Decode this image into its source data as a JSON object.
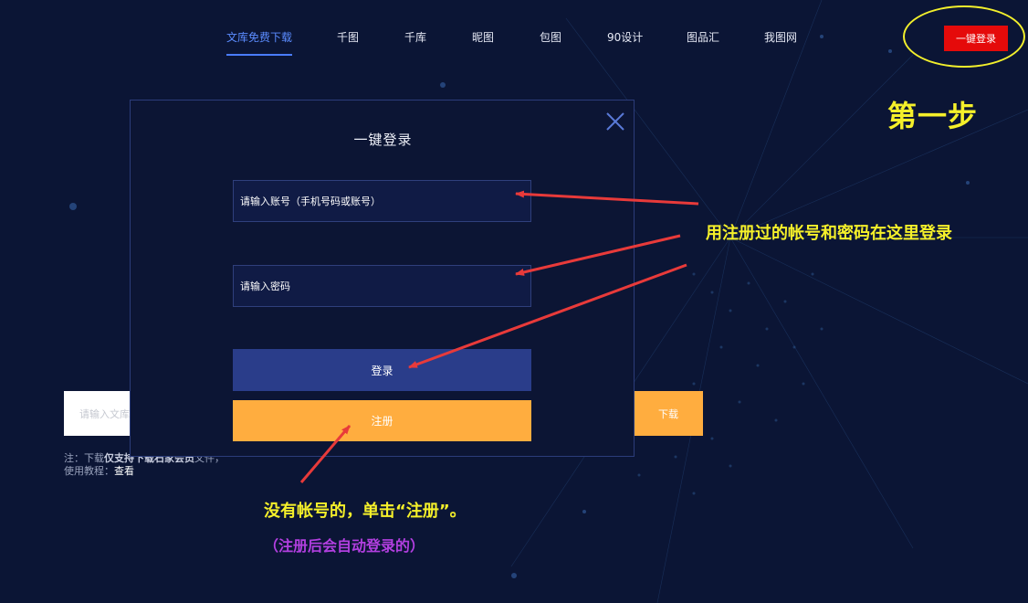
{
  "nav": {
    "items": [
      {
        "label": "文库免费下载",
        "active": true
      },
      {
        "label": "千图",
        "active": false
      },
      {
        "label": "千库",
        "active": false
      },
      {
        "label": "昵图",
        "active": false
      },
      {
        "label": "包图",
        "active": false
      },
      {
        "label": "90设计",
        "active": false
      },
      {
        "label": "图品汇",
        "active": false
      },
      {
        "label": "我图网",
        "active": false
      }
    ],
    "login_button": "一键登录"
  },
  "annotations": {
    "step": "第一步",
    "login_hint": "用注册过的帐号和密码在这里登录",
    "register_hint": "没有帐号的，单击“注册”。",
    "register_sub": "（注册后会自动登录的）"
  },
  "modal": {
    "title": "一键登录",
    "account_placeholder": "请输入账号（手机号码或账号）",
    "password_placeholder": "请输入密码",
    "login_button": "登录",
    "register_button": "注册"
  },
  "page": {
    "search_placeholder": "请输入文库",
    "download_button": "下载",
    "note_prefix": "注：下载",
    "note_bold": "仅支持下载石家会员",
    "note_suffix": "文件，",
    "tutorial_label": "使用教程：",
    "tutorial_link": "查看"
  },
  "colors": {
    "background": "#0b1535",
    "accent_blue": "#4a7cff",
    "login_red": "#e50a0a",
    "register_orange": "#ffad3f",
    "login_blue": "#2a3d8a",
    "annotation_yellow": "#f5f02a",
    "annotation_purple": "#b23fe0",
    "arrow_red": "#e83a3a"
  }
}
